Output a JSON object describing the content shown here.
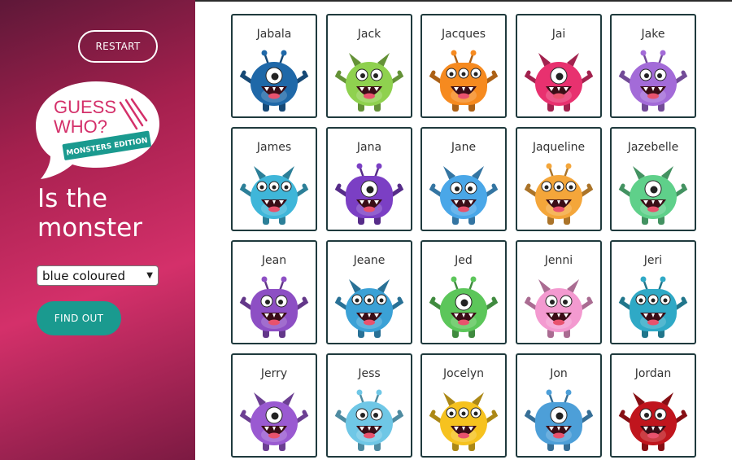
{
  "sidebar": {
    "restart_label": "RESTART",
    "logo": {
      "line1": "GUESS",
      "line2": "WHO?",
      "subtitle": "MONSTERS EDITION"
    },
    "question_line1": "Is the",
    "question_line2": "monster",
    "select_value": "blue coloured",
    "find_out_label": "FIND OUT"
  },
  "colors": {
    "sidebar_pink": "#d4306a",
    "teal": "#1a9a8f",
    "card_border": "#1f3a3d"
  },
  "cards": [
    {
      "name": "Jabala",
      "color": "#1f68a8",
      "icon": "blue-one-eyed-monster"
    },
    {
      "name": "Jack",
      "color": "#8fd14f",
      "icon": "green-furry-monster"
    },
    {
      "name": "Jacques",
      "color": "#f68a1f",
      "icon": "orange-bear-monster"
    },
    {
      "name": "Jai",
      "color": "#e8316f",
      "icon": "pink-horned-monster"
    },
    {
      "name": "Jake",
      "color": "#a36bd8",
      "icon": "purple-antenna-monster"
    },
    {
      "name": "James",
      "color": "#3fb6d9",
      "icon": "blue-winged-monster"
    },
    {
      "name": "Jana",
      "color": "#7b3fc4",
      "icon": "purple-three-eyed-monster"
    },
    {
      "name": "Jane",
      "color": "#4aa7e8",
      "icon": "blue-bat-monster"
    },
    {
      "name": "Jaqueline",
      "color": "#f4a63a",
      "icon": "orange-horned-monster"
    },
    {
      "name": "Jazebelle",
      "color": "#5fd08a",
      "icon": "green-spiky-monster"
    },
    {
      "name": "Jean",
      "color": "#8d4fc4",
      "icon": "purple-dragon-monster"
    },
    {
      "name": "Jeane",
      "color": "#3ba1d6",
      "icon": "blue-bull-monster"
    },
    {
      "name": "Jed",
      "color": "#5cc65a",
      "icon": "green-three-eyed-monster"
    },
    {
      "name": "Jenni",
      "color": "#f39ad0",
      "icon": "pink-blob-monster"
    },
    {
      "name": "Jeri",
      "color": "#2fa9c6",
      "icon": "teal-antenna-monster"
    },
    {
      "name": "Jerry",
      "color": "#9a5ad1",
      "icon": "purple-furry-monster"
    },
    {
      "name": "Jess",
      "color": "#6fc7e6",
      "icon": "blue-eyeball-monster"
    },
    {
      "name": "Jocelyn",
      "color": "#f6c21f",
      "icon": "yellow-candy-monster"
    },
    {
      "name": "Jon",
      "color": "#4d9fd8",
      "icon": "blue-coffee-monster"
    },
    {
      "name": "Jordan",
      "color": "#c0151d",
      "icon": "red-devil-monster"
    }
  ]
}
